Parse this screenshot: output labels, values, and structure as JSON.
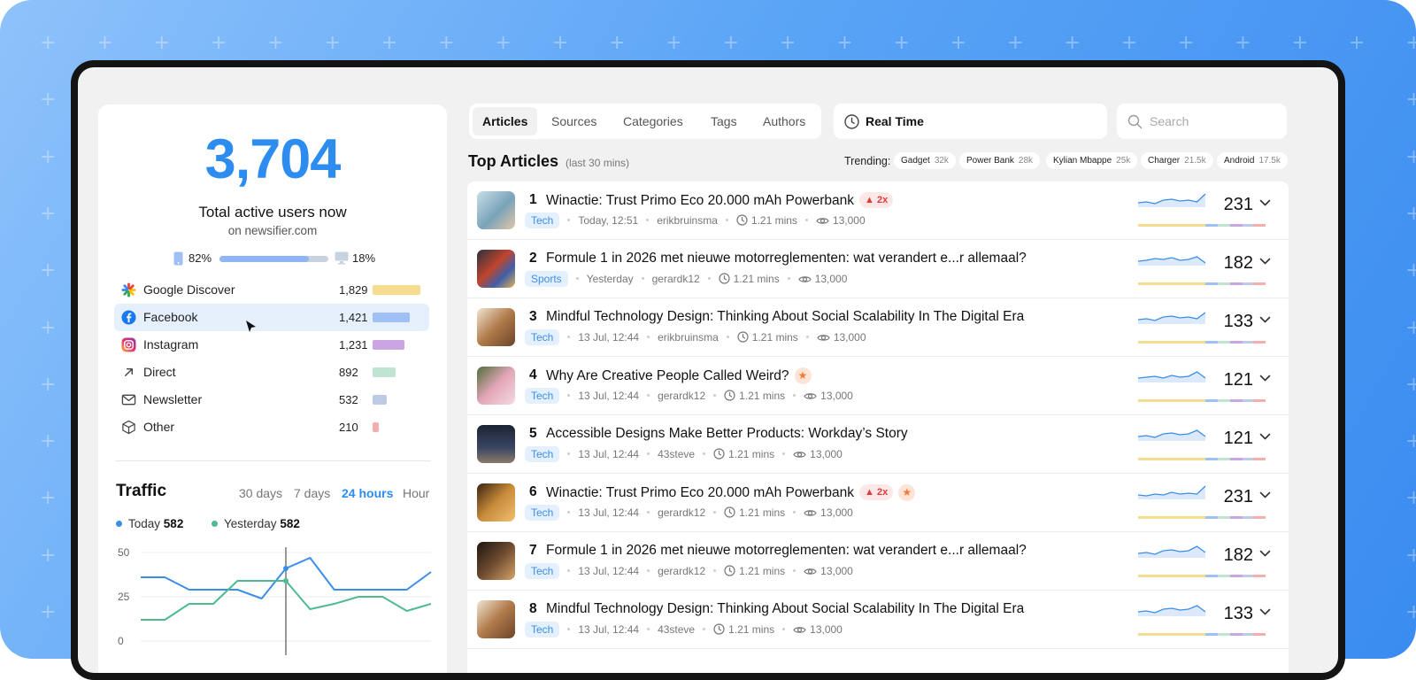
{
  "summary": {
    "active_users": "3,704",
    "label": "Total active users now",
    "site": "on newsifier.com",
    "mobile_pct": "82%",
    "desktop_pct": "18%",
    "mobile_share": 0.82
  },
  "sources": [
    {
      "name": "Google Discover",
      "value": "1,829",
      "icon": "google-discover-icon",
      "color": "#f5dc8e",
      "share": 0.4
    },
    {
      "name": "Facebook",
      "value": "1,421",
      "icon": "facebook-icon",
      "color": "#9fc0f5",
      "share": 0.31
    },
    {
      "name": "Instagram",
      "value": "1,231",
      "icon": "instagram-icon",
      "color": "#c9a6e3",
      "share": 0.27
    },
    {
      "name": "Direct",
      "value": "892",
      "icon": "arrow-up-right-icon",
      "color": "#bfe5d2",
      "share": 0.19
    },
    {
      "name": "Newsletter",
      "value": "532",
      "icon": "mail-icon",
      "color": "#bccbe6",
      "share": 0.12
    },
    {
      "name": "Other",
      "value": "210",
      "icon": "cube-icon",
      "color": "#f4aeb0",
      "share": 0.05
    }
  ],
  "traffic": {
    "title": "Traffic",
    "ranges": [
      "30 days",
      "7 days",
      "24 hours",
      "Hour"
    ],
    "active_range": "24 hours",
    "today_label": "Today",
    "today_value": "582",
    "yesterday_label": "Yesterday",
    "yesterday_value": "582",
    "colors": {
      "today": "#3b8ee8",
      "yesterday": "#4dbb8f"
    }
  },
  "chart_data": {
    "type": "line",
    "y_ticks": [
      "50",
      "25",
      "0"
    ],
    "ylim": [
      0,
      50
    ],
    "grid": true,
    "series": [
      {
        "name": "Today",
        "values": [
          36,
          36,
          29,
          29,
          29,
          24,
          41,
          47,
          29,
          29,
          29,
          29,
          39
        ]
      },
      {
        "name": "Yesterday",
        "values": [
          12,
          12,
          21,
          21,
          34,
          34,
          34,
          18,
          21,
          25,
          25,
          17,
          21
        ]
      }
    ]
  },
  "nav": {
    "tabs": [
      "Articles",
      "Sources",
      "Categories",
      "Tags",
      "Authors"
    ],
    "active_tab": "Articles",
    "realtime": "Real Time",
    "search_placeholder": "Search"
  },
  "top": {
    "title": "Top Articles",
    "subtitle": "(last 30 mins)",
    "trending_label": "Trending:",
    "trending": [
      {
        "term": "Gadget",
        "count": "32k"
      },
      {
        "term": "Power Bank",
        "count": "28k"
      },
      {
        "term": "Kylian Mbappe",
        "count": "25k"
      },
      {
        "term": "Charger",
        "count": "21.5k"
      },
      {
        "term": "Android",
        "count": "17.5k"
      }
    ]
  },
  "articles": [
    {
      "rank": "1",
      "title": "Winactie: Trust Primo Eco 20.000 mAh Powerbank",
      "badge": "2x",
      "star": false,
      "category": "Tech",
      "date": "Today, 12:51",
      "author": "erikbruinsma",
      "read": "1.21 mins",
      "views": "13,000",
      "count": "231"
    },
    {
      "rank": "2",
      "title": "Formule 1 in 2026 met nieuwe motorreglementen: wat verandert e...r allemaal?",
      "badge": "",
      "star": false,
      "category": "Sports",
      "date": "Yesterday",
      "author": "gerardk12",
      "read": "1.21 mins",
      "views": "13,000",
      "count": "182"
    },
    {
      "rank": "3",
      "title": "Mindful Technology Design: Thinking About Social Scalability In The Digital Era",
      "badge": "",
      "star": false,
      "category": "Tech",
      "date": "13 Jul, 12:44",
      "author": "erikbruinsma",
      "read": "1.21 mins",
      "views": "13,000",
      "count": "133"
    },
    {
      "rank": "4",
      "title": "Why Are Creative People Called Weird?",
      "badge": "",
      "star": true,
      "category": "Tech",
      "date": "13 Jul, 12:44",
      "author": "gerardk12",
      "read": "1.21 mins",
      "views": "13,000",
      "count": "121"
    },
    {
      "rank": "5",
      "title": "Accessible Designs Make Better Products: Workday’s Story",
      "badge": "",
      "star": false,
      "category": "Tech",
      "date": "13 Jul, 12:44",
      "author": "43steve",
      "read": "1.21 mins",
      "views": "13,000",
      "count": "121"
    },
    {
      "rank": "6",
      "title": "Winactie: Trust Primo Eco 20.000 mAh Powerbank",
      "badge": "2x",
      "star": true,
      "category": "Tech",
      "date": "13 Jul, 12:44",
      "author": "gerardk12",
      "read": "1.21 mins",
      "views": "13,000",
      "count": "231"
    },
    {
      "rank": "7",
      "title": "Formule 1 in 2026 met nieuwe motorreglementen: wat verandert e...r allemaal?",
      "badge": "",
      "star": false,
      "category": "Tech",
      "date": "13 Jul, 12:44",
      "author": "gerardk12",
      "read": "1.21 mins",
      "views": "13,000",
      "count": "182"
    },
    {
      "rank": "8",
      "title": "Mindful Technology Design: Thinking About Social Scalability In The Digital Era",
      "badge": "",
      "star": false,
      "category": "Tech",
      "date": "13 Jul, 12:44",
      "author": "43steve",
      "read": "1.21 mins",
      "views": "13,000",
      "count": "133"
    }
  ]
}
